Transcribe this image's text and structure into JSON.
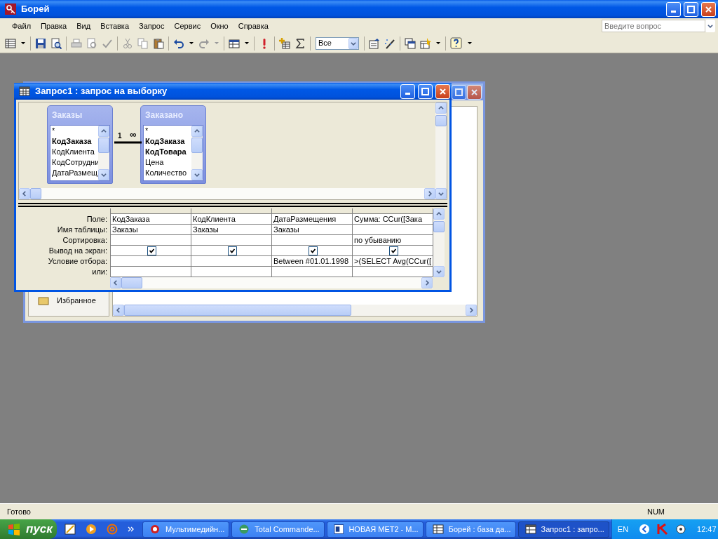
{
  "app": {
    "title": "Борей"
  },
  "menu": [
    "Файл",
    "Правка",
    "Вид",
    "Вставка",
    "Запрос",
    "Сервис",
    "Окно",
    "Справка"
  ],
  "help_box": {
    "placeholder": "Введите вопрос"
  },
  "toolbar": {
    "filter_combo": "Все"
  },
  "db_window": {
    "sidebar_items": [
      "Избранное"
    ]
  },
  "query_window": {
    "title": "Запрос1 : запрос на выборку",
    "tables": [
      {
        "name": "Заказы",
        "fields": [
          {
            "name": "*",
            "key": false
          },
          {
            "name": "КодЗаказа",
            "key": true
          },
          {
            "name": "КодКлиента",
            "key": false
          },
          {
            "name": "КодСотрудни",
            "key": false
          },
          {
            "name": "ДатаРазмещ",
            "key": false
          }
        ]
      },
      {
        "name": "Заказано",
        "fields": [
          {
            "name": "*",
            "key": false
          },
          {
            "name": "КодЗаказа",
            "key": true
          },
          {
            "name": "КодТовара",
            "key": true
          },
          {
            "name": "Цена",
            "key": false
          },
          {
            "name": "Количество",
            "key": false
          }
        ]
      }
    ],
    "relation": {
      "one": "1",
      "many": "∞"
    },
    "grid": {
      "row_labels": [
        "Поле:",
        "Имя таблицы:",
        "Сортировка:",
        "Вывод на экран:",
        "Условие отбора:",
        "или:"
      ],
      "columns": [
        {
          "field": "КодЗаказа",
          "table": "Заказы",
          "show": true
        },
        {
          "field": "КодКлиента",
          "table": "Заказы",
          "show": true
        },
        {
          "field": "ДатаРазмещения",
          "table": "Заказы",
          "show": true,
          "criteria": "Between #01.01.1998"
        },
        {
          "field": "Сумма: CCur([Зака",
          "sort": "по убыванию",
          "show": true,
          "criteria": ">(SELECT Avg(CCur(["
        }
      ]
    }
  },
  "status_bar": {
    "text": "Готово",
    "num": "NUM"
  },
  "taskbar": {
    "start": "пуск",
    "tasks": [
      {
        "label": "Мультимедийн...",
        "selected": false
      },
      {
        "label": "Total Commande...",
        "selected": false
      },
      {
        "label": "НОВАЯ МЕТ2 - М...",
        "selected": false
      },
      {
        "label": "Борей : база да...",
        "selected": false
      },
      {
        "label": "Запрос1 : запро...",
        "selected": true
      }
    ],
    "lang": "EN",
    "clock": "12:47"
  }
}
